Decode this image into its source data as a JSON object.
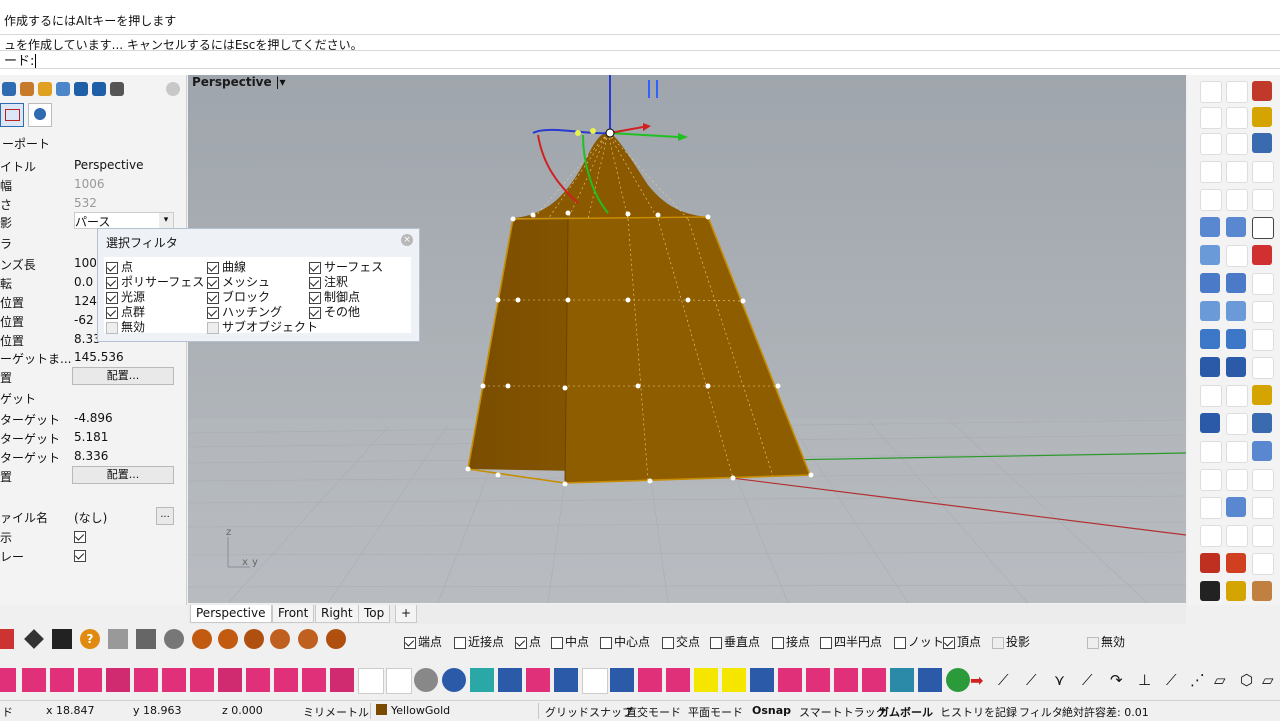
{
  "command": {
    "line1": "作成するにはAltキーを押します",
    "line2": "ュを作成しています... キャンセルするにはEscを押してください。",
    "prompt": "ード:"
  },
  "left_panel": {
    "section_viewport": "ーポート",
    "rows": [
      {
        "key": "イトル",
        "value": "Perspective"
      },
      {
        "key": "",
        "value": "1006"
      },
      {
        "key": "さ",
        "value": "532"
      },
      {
        "key": "影",
        "value": "パース"
      },
      {
        "key": "ラ",
        "value": ""
      },
      {
        "key": "ンズ長",
        "value": "100"
      },
      {
        "key": "転",
        "value": "0.0"
      },
      {
        "key": "位置",
        "value": "124"
      },
      {
        "key": "位置",
        "value": "-62"
      },
      {
        "key": "位置",
        "value": "8.33"
      },
      {
        "key": "ーゲットま...",
        "value": "145.536"
      },
      {
        "key": "置",
        "value": "配置..."
      },
      {
        "key": "ゲット",
        "value": ""
      },
      {
        "key": "ターゲット",
        "value": "-4.896"
      },
      {
        "key": "ターゲット",
        "value": "5.181"
      },
      {
        "key": "ターゲット",
        "value": "8.336"
      },
      {
        "key": "置",
        "value": "配置..."
      },
      {
        "key": "ァイル名",
        "value": "(なし)"
      },
      {
        "key": "示",
        "value": ""
      },
      {
        "key": "レー",
        "value": ""
      }
    ],
    "place_button": "配置...",
    "browse_button": "..."
  },
  "viewport": {
    "title": "Perspective",
    "axis_z": "z",
    "axis_x": "x",
    "axis_y": "y"
  },
  "filter_dialog": {
    "title": "選択フィルタ",
    "items": [
      {
        "label": "点",
        "checked": true
      },
      {
        "label": "曲線",
        "checked": true
      },
      {
        "label": "サーフェス",
        "checked": true
      },
      {
        "label": "ポリサーフェス",
        "checked": true
      },
      {
        "label": "メッシュ",
        "checked": true
      },
      {
        "label": "注釈",
        "checked": true
      },
      {
        "label": "光源",
        "checked": true
      },
      {
        "label": "ブロック",
        "checked": true
      },
      {
        "label": "制御点",
        "checked": true
      },
      {
        "label": "点群",
        "checked": true
      },
      {
        "label": "ハッチング",
        "checked": true
      },
      {
        "label": "その他",
        "checked": true
      },
      {
        "label": "無効",
        "checked": false
      },
      {
        "label": "サブオブジェクト",
        "checked": false
      }
    ]
  },
  "viewport_tabs": [
    "Perspective",
    "Front",
    "Right",
    "Top",
    "+"
  ],
  "osnap": [
    {
      "label": "端点",
      "checked": true
    },
    {
      "label": "近接点",
      "checked": false
    },
    {
      "label": "点",
      "checked": true
    },
    {
      "label": "中点",
      "checked": false
    },
    {
      "label": "中心点",
      "checked": false
    },
    {
      "label": "交点",
      "checked": false
    },
    {
      "label": "垂直点",
      "checked": false
    },
    {
      "label": "接点",
      "checked": false
    },
    {
      "label": "四半円点",
      "checked": false
    },
    {
      "label": "ノット",
      "checked": false
    },
    {
      "label": "頂点",
      "checked": true
    },
    {
      "label": "投影",
      "checked": false
    },
    {
      "label": "無効",
      "checked": false
    }
  ],
  "status": {
    "cmd": "ド",
    "x": "x 18.847",
    "y": "y 18.963",
    "z": "z 0.000",
    "unit": "ミリメートル",
    "layer": "YellowGold",
    "layer_color": "#7a4a00",
    "toggles": [
      "グリッドスナップ",
      "直交モード",
      "平面モード",
      "Osnap",
      "スマートトラック",
      "ガムボール",
      "ヒストリを記録",
      "フィルタ"
    ],
    "tolerance": "絶対許容差: 0.01"
  },
  "colors": {
    "viewport_bg": "#a9aeb4",
    "object": "#8a5a00",
    "edge": "#c28a00"
  }
}
